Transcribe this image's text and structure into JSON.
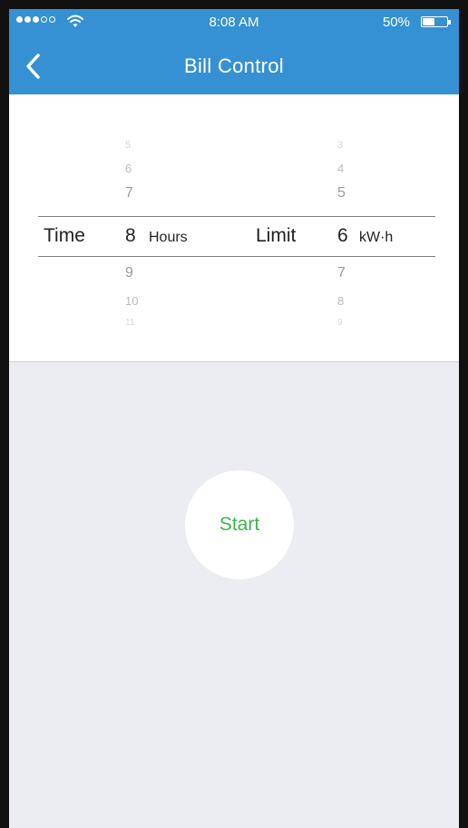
{
  "status_bar": {
    "time": "8:08 AM",
    "battery_percent": "50%",
    "signal_strength": 3,
    "signal_max": 5,
    "battery_level": 0.5
  },
  "nav": {
    "title": "Bill Control",
    "back_icon": "chevron-left-icon"
  },
  "picker": {
    "time": {
      "label": "Time",
      "value": "8",
      "unit": "Hours",
      "above": [
        "5",
        "6",
        "7"
      ],
      "below": [
        "9",
        "10",
        "11"
      ]
    },
    "limit": {
      "label": "Limit",
      "value": "6",
      "unit": "kW·h",
      "above": [
        "3",
        "4",
        "5"
      ],
      "below": [
        "7",
        "8",
        "9"
      ]
    }
  },
  "action": {
    "start_label": "Start"
  },
  "colors": {
    "header": "#3591d3",
    "start_text": "#3cb54a",
    "background": "#ecedf2"
  }
}
